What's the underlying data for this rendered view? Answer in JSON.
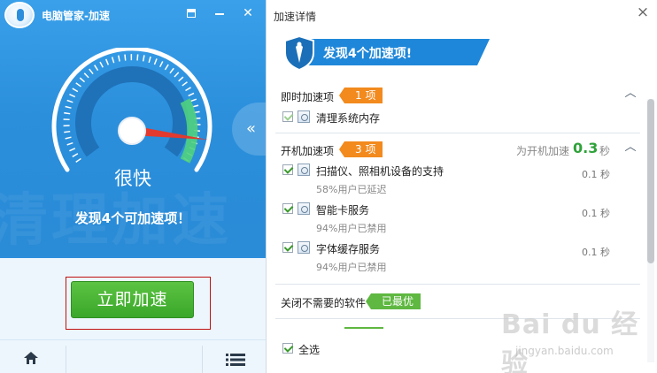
{
  "left": {
    "app_title": "电脑管家-加速",
    "speed_label": "很快",
    "found_message": "发现4个可加速项！",
    "accelerate_button": "立即加速",
    "collapse_handle": "«",
    "watermark_text": "清理加速"
  },
  "right": {
    "title": "加速详情",
    "close": "×",
    "banner_text": "发现4个加速项!",
    "sections": [
      {
        "title": "即时加速项",
        "tag": "1 项",
        "items": [
          {
            "name": "清理系统内存",
            "checked": true
          }
        ]
      },
      {
        "title": "开机加速项",
        "tag": "3 项",
        "boost_prefix": "为开机加速",
        "boost_value": "0.3",
        "boost_unit": "秒",
        "items": [
          {
            "name": "扫描仪、照相机设备的支持",
            "sub": "58%用户已延迟",
            "time": "0.1 秒",
            "checked": true
          },
          {
            "name": "智能卡服务",
            "sub": "94%用户已禁用",
            "time": "0.1 秒",
            "checked": true
          },
          {
            "name": "字体缓存服务",
            "sub": "94%用户已禁用",
            "time": "0.1 秒",
            "checked": true
          }
        ]
      },
      {
        "title": "关闭不需要的软件",
        "tag": "已最优"
      }
    ],
    "select_all": "全选"
  },
  "watermark": {
    "logo": "Bai du 经验",
    "url": "jingyan.baidu.com"
  },
  "colors": {
    "left_panel": "#2d8fdc",
    "accelerate_button": "#3aa72a",
    "orange_tag": "#f28a1e",
    "green_tag": "#5fb841",
    "banner": "#1f87d9"
  }
}
